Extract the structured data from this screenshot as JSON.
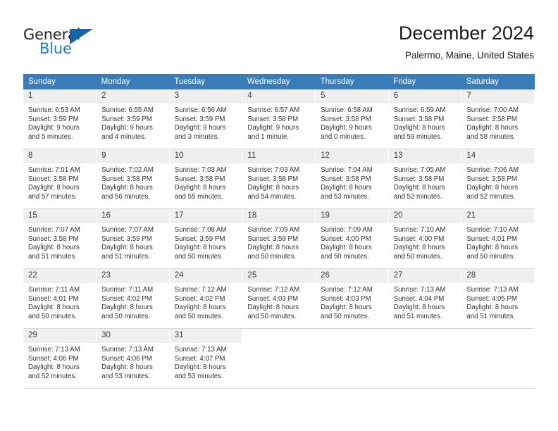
{
  "brand": {
    "name_top": "General",
    "name_bottom": "Blue",
    "triangle_color": "#1665a8",
    "blue_color": "#1f7ac4"
  },
  "header": {
    "month_title": "December 2024",
    "location": "Palermo, Maine, United States",
    "header_bg": "#3a7cb8"
  },
  "weekdays": [
    "Sunday",
    "Monday",
    "Tuesday",
    "Wednesday",
    "Thursday",
    "Friday",
    "Saturday"
  ],
  "weeks": [
    [
      {
        "day": "1",
        "sunrise": "Sunrise: 6:53 AM",
        "sunset": "Sunset: 3:59 PM",
        "daylight_line1": "Daylight: 9 hours",
        "daylight_line2": "and 5 minutes."
      },
      {
        "day": "2",
        "sunrise": "Sunrise: 6:55 AM",
        "sunset": "Sunset: 3:59 PM",
        "daylight_line1": "Daylight: 9 hours",
        "daylight_line2": "and 4 minutes."
      },
      {
        "day": "3",
        "sunrise": "Sunrise: 6:56 AM",
        "sunset": "Sunset: 3:59 PM",
        "daylight_line1": "Daylight: 9 hours",
        "daylight_line2": "and 3 minutes."
      },
      {
        "day": "4",
        "sunrise": "Sunrise: 6:57 AM",
        "sunset": "Sunset: 3:58 PM",
        "daylight_line1": "Daylight: 9 hours",
        "daylight_line2": "and 1 minute."
      },
      {
        "day": "5",
        "sunrise": "Sunrise: 6:58 AM",
        "sunset": "Sunset: 3:58 PM",
        "daylight_line1": "Daylight: 9 hours",
        "daylight_line2": "and 0 minutes."
      },
      {
        "day": "6",
        "sunrise": "Sunrise: 6:59 AM",
        "sunset": "Sunset: 3:58 PM",
        "daylight_line1": "Daylight: 8 hours",
        "daylight_line2": "and 59 minutes."
      },
      {
        "day": "7",
        "sunrise": "Sunrise: 7:00 AM",
        "sunset": "Sunset: 3:58 PM",
        "daylight_line1": "Daylight: 8 hours",
        "daylight_line2": "and 58 minutes."
      }
    ],
    [
      {
        "day": "8",
        "sunrise": "Sunrise: 7:01 AM",
        "sunset": "Sunset: 3:58 PM",
        "daylight_line1": "Daylight: 8 hours",
        "daylight_line2": "and 57 minutes."
      },
      {
        "day": "9",
        "sunrise": "Sunrise: 7:02 AM",
        "sunset": "Sunset: 3:58 PM",
        "daylight_line1": "Daylight: 8 hours",
        "daylight_line2": "and 56 minutes."
      },
      {
        "day": "10",
        "sunrise": "Sunrise: 7:03 AM",
        "sunset": "Sunset: 3:58 PM",
        "daylight_line1": "Daylight: 8 hours",
        "daylight_line2": "and 55 minutes."
      },
      {
        "day": "11",
        "sunrise": "Sunrise: 7:03 AM",
        "sunset": "Sunset: 3:58 PM",
        "daylight_line1": "Daylight: 8 hours",
        "daylight_line2": "and 54 minutes."
      },
      {
        "day": "12",
        "sunrise": "Sunrise: 7:04 AM",
        "sunset": "Sunset: 3:58 PM",
        "daylight_line1": "Daylight: 8 hours",
        "daylight_line2": "and 53 minutes."
      },
      {
        "day": "13",
        "sunrise": "Sunrise: 7:05 AM",
        "sunset": "Sunset: 3:58 PM",
        "daylight_line1": "Daylight: 8 hours",
        "daylight_line2": "and 52 minutes."
      },
      {
        "day": "14",
        "sunrise": "Sunrise: 7:06 AM",
        "sunset": "Sunset: 3:58 PM",
        "daylight_line1": "Daylight: 8 hours",
        "daylight_line2": "and 52 minutes."
      }
    ],
    [
      {
        "day": "15",
        "sunrise": "Sunrise: 7:07 AM",
        "sunset": "Sunset: 3:58 PM",
        "daylight_line1": "Daylight: 8 hours",
        "daylight_line2": "and 51 minutes."
      },
      {
        "day": "16",
        "sunrise": "Sunrise: 7:07 AM",
        "sunset": "Sunset: 3:59 PM",
        "daylight_line1": "Daylight: 8 hours",
        "daylight_line2": "and 51 minutes."
      },
      {
        "day": "17",
        "sunrise": "Sunrise: 7:08 AM",
        "sunset": "Sunset: 3:59 PM",
        "daylight_line1": "Daylight: 8 hours",
        "daylight_line2": "and 50 minutes."
      },
      {
        "day": "18",
        "sunrise": "Sunrise: 7:09 AM",
        "sunset": "Sunset: 3:59 PM",
        "daylight_line1": "Daylight: 8 hours",
        "daylight_line2": "and 50 minutes."
      },
      {
        "day": "19",
        "sunrise": "Sunrise: 7:09 AM",
        "sunset": "Sunset: 4:00 PM",
        "daylight_line1": "Daylight: 8 hours",
        "daylight_line2": "and 50 minutes."
      },
      {
        "day": "20",
        "sunrise": "Sunrise: 7:10 AM",
        "sunset": "Sunset: 4:00 PM",
        "daylight_line1": "Daylight: 8 hours",
        "daylight_line2": "and 50 minutes."
      },
      {
        "day": "21",
        "sunrise": "Sunrise: 7:10 AM",
        "sunset": "Sunset: 4:01 PM",
        "daylight_line1": "Daylight: 8 hours",
        "daylight_line2": "and 50 minutes."
      }
    ],
    [
      {
        "day": "22",
        "sunrise": "Sunrise: 7:11 AM",
        "sunset": "Sunset: 4:01 PM",
        "daylight_line1": "Daylight: 8 hours",
        "daylight_line2": "and 50 minutes."
      },
      {
        "day": "23",
        "sunrise": "Sunrise: 7:11 AM",
        "sunset": "Sunset: 4:02 PM",
        "daylight_line1": "Daylight: 8 hours",
        "daylight_line2": "and 50 minutes."
      },
      {
        "day": "24",
        "sunrise": "Sunrise: 7:12 AM",
        "sunset": "Sunset: 4:02 PM",
        "daylight_line1": "Daylight: 8 hours",
        "daylight_line2": "and 50 minutes."
      },
      {
        "day": "25",
        "sunrise": "Sunrise: 7:12 AM",
        "sunset": "Sunset: 4:03 PM",
        "daylight_line1": "Daylight: 8 hours",
        "daylight_line2": "and 50 minutes."
      },
      {
        "day": "26",
        "sunrise": "Sunrise: 7:12 AM",
        "sunset": "Sunset: 4:03 PM",
        "daylight_line1": "Daylight: 8 hours",
        "daylight_line2": "and 50 minutes."
      },
      {
        "day": "27",
        "sunrise": "Sunrise: 7:13 AM",
        "sunset": "Sunset: 4:04 PM",
        "daylight_line1": "Daylight: 8 hours",
        "daylight_line2": "and 51 minutes."
      },
      {
        "day": "28",
        "sunrise": "Sunrise: 7:13 AM",
        "sunset": "Sunset: 4:05 PM",
        "daylight_line1": "Daylight: 8 hours",
        "daylight_line2": "and 51 minutes."
      }
    ],
    [
      {
        "day": "29",
        "sunrise": "Sunrise: 7:13 AM",
        "sunset": "Sunset: 4:06 PM",
        "daylight_line1": "Daylight: 8 hours",
        "daylight_line2": "and 52 minutes."
      },
      {
        "day": "30",
        "sunrise": "Sunrise: 7:13 AM",
        "sunset": "Sunset: 4:06 PM",
        "daylight_line1": "Daylight: 8 hours",
        "daylight_line2": "and 53 minutes."
      },
      {
        "day": "31",
        "sunrise": "Sunrise: 7:13 AM",
        "sunset": "Sunset: 4:07 PM",
        "daylight_line1": "Daylight: 8 hours",
        "daylight_line2": "and 53 minutes."
      },
      {
        "day": "",
        "sunrise": "",
        "sunset": "",
        "daylight_line1": "",
        "daylight_line2": ""
      },
      {
        "day": "",
        "sunrise": "",
        "sunset": "",
        "daylight_line1": "",
        "daylight_line2": ""
      },
      {
        "day": "",
        "sunrise": "",
        "sunset": "",
        "daylight_line1": "",
        "daylight_line2": ""
      },
      {
        "day": "",
        "sunrise": "",
        "sunset": "",
        "daylight_line1": "",
        "daylight_line2": ""
      }
    ]
  ]
}
